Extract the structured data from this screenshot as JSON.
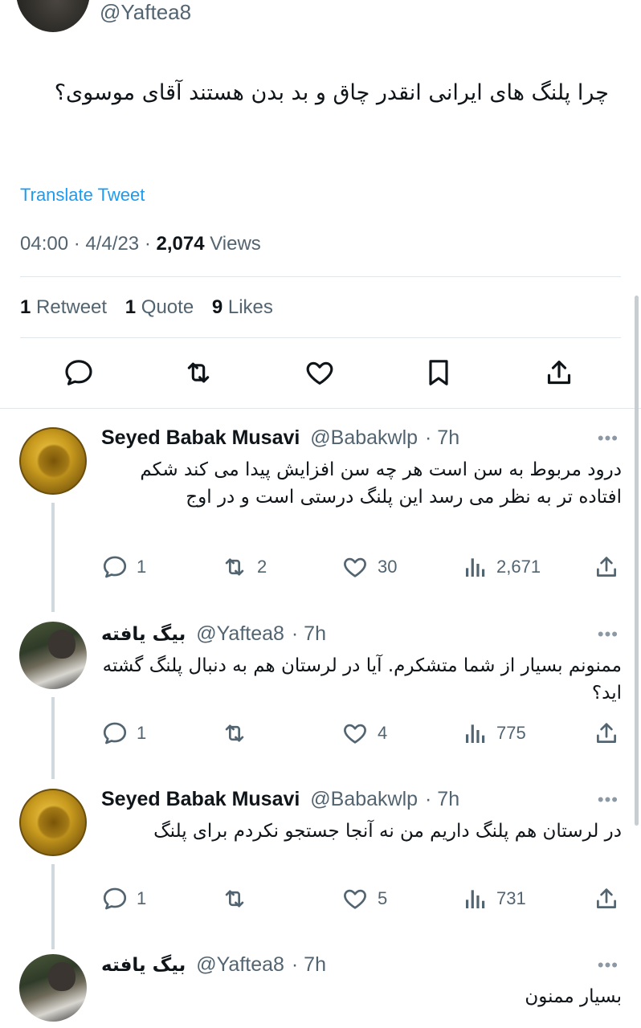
{
  "main_tweet": {
    "handle": "@Yaftea8",
    "text": "چرا پلنگ های ایرانی انقدر چاق و بد بدن هستند آقای موسوی؟",
    "translate_label": "Translate Tweet",
    "time": "04:00",
    "date": "4/4/23",
    "views_count": "2,074",
    "views_label": "Views",
    "sep": "·",
    "stats": {
      "retweets_count": "1",
      "retweets_label": "Retweet",
      "quotes_count": "1",
      "quotes_label": "Quote",
      "likes_count": "9",
      "likes_label": "Likes"
    },
    "actions": [
      "reply-icon",
      "retweet-icon",
      "like-icon",
      "bookmark-icon",
      "share-icon"
    ]
  },
  "replies": [
    {
      "name": "Seyed Babak Musavi",
      "handle": "@Babakwlp",
      "time": "· 7h",
      "more": "•••",
      "text": "درود مربوط به سن است هر چه سن افزایش پیدا می کند شکم افتاده تر به نظر می رسد این پلنگ درستی است و در اوج",
      "replies": "1",
      "retweets": "2",
      "likes": "30",
      "views": "2,671"
    },
    {
      "name": "بیگ یافته",
      "handle": "@Yaftea8",
      "time": "· 7h",
      "more": "•••",
      "text": "ممنونم بسیار از شما متشکرم. آیا در لرستان هم به دنبال پلنگ گشته اید؟",
      "replies": "1",
      "retweets": "",
      "likes": "4",
      "views": "775"
    },
    {
      "name": "Seyed Babak Musavi",
      "handle": "@Babakwlp",
      "time": "· 7h",
      "more": "•••",
      "text": "در لرستان هم پلنگ داریم من نه آنجا جستجو نکردم برای پلنگ",
      "replies": "1",
      "retweets": "",
      "likes": "5",
      "views": "731"
    },
    {
      "name": "بیگ یافته",
      "handle": "@Yaftea8",
      "time": "· 7h",
      "more": "•••",
      "text": "بسیار ممنون"
    }
  ],
  "colors": {
    "accent": "#1d9bf0",
    "text": "#0f1419",
    "secondary": "#536471",
    "divider": "#e1e6ea"
  }
}
